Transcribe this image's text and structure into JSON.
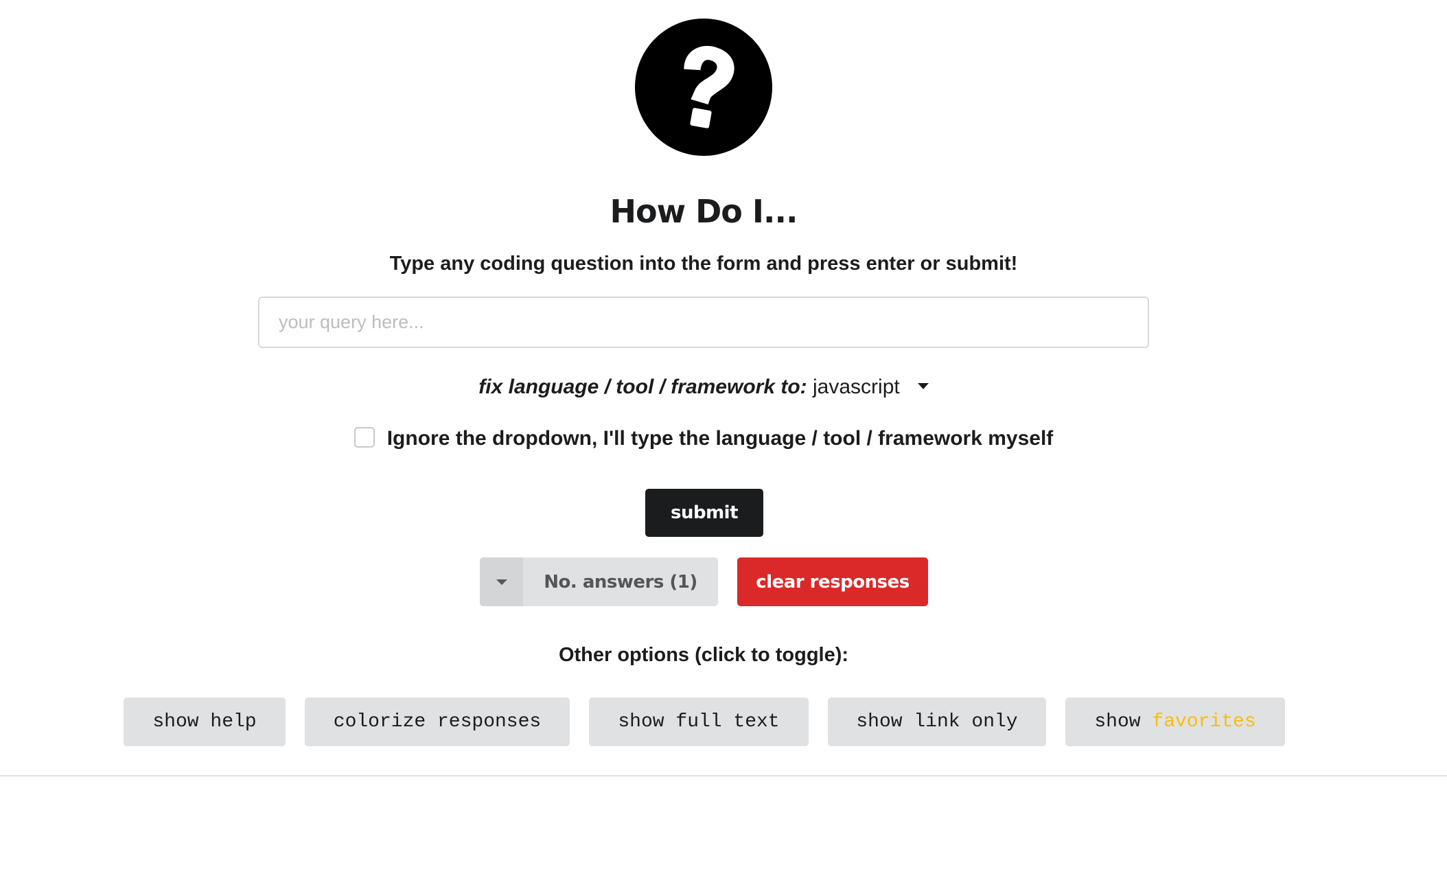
{
  "header": {
    "logo_icon": "question-circle-icon",
    "title": "How Do I...",
    "subtitle": "Type any coding question into the form and press enter or submit!"
  },
  "search": {
    "value": "",
    "placeholder": "your query here..."
  },
  "language": {
    "label": "fix language / tool / framework to:",
    "selected": "javascript",
    "caret_icon": "caret-down-icon"
  },
  "ignore_dropdown": {
    "checked": false,
    "label": "Ignore the dropdown, I'll type the language / tool / framework myself"
  },
  "actions": {
    "submit_label": "submit",
    "answers_label": "No. answers (1)",
    "clear_label": "clear responses"
  },
  "options": {
    "heading": "Other options (click to toggle):",
    "buttons": [
      {
        "label": "show help"
      },
      {
        "label": "colorize responses"
      },
      {
        "label": "show full text"
      },
      {
        "label": "show link only"
      },
      {
        "label": "show ",
        "highlight": "favorites"
      }
    ]
  },
  "colors": {
    "primary": "#1b1c1d",
    "danger": "#db2828",
    "favorites": "#fbbd08",
    "button_gray": "#e0e1e2"
  }
}
